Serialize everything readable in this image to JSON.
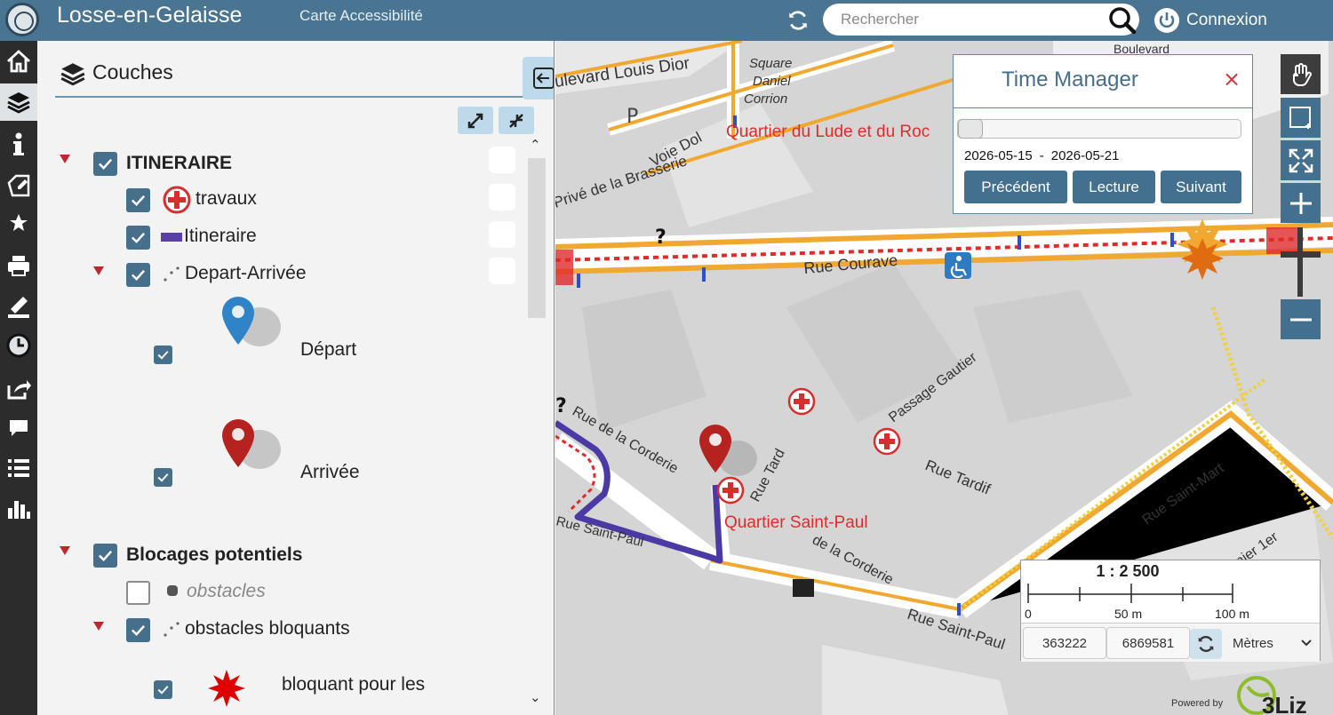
{
  "header": {
    "title": "Losse-en-Gelaisse",
    "subtitle": "Carte Accessibilité",
    "search_placeholder": "Rechercher",
    "login_label": "Connexion"
  },
  "menu": {
    "items": [
      "home-icon",
      "layers-icon",
      "info-icon",
      "edit-icon",
      "star-icon",
      "print-icon",
      "measure-icon",
      "clock-icon",
      "share-icon",
      "comment-icon",
      "list-icon",
      "chart-icon"
    ],
    "active": "layers-icon"
  },
  "panel": {
    "title": "Couches",
    "layers": {
      "itineraire": "ITINERAIRE",
      "travaux": "travaux",
      "itineraire_line": "Itineraire",
      "depart_arrivee": "Depart-Arrivée",
      "depart": "Départ",
      "arrivee": "Arrivée",
      "blocages": "Blocages potentiels",
      "obstacles": "obstacles",
      "obstacles_bloquants": "obstacles bloquants",
      "bloquant": "bloquant pour les"
    }
  },
  "map": {
    "labels": {
      "boulevard": "ulevard Louis Dior",
      "square": "Square",
      "square2": "Daniel",
      "square3": "Corrion",
      "quartier_lude": "Quartier du Lude et du Roc",
      "voie": "Voie Dol",
      "brasserie": "Privé de la Brasserie",
      "courave": "Rue Courave",
      "gautier": "Passage Gautier",
      "corderie": "Rue de la Corderie",
      "tardif": "Rue Tardif",
      "rue_tard": "Rue Tard",
      "quartier_saint_paul": "Quartier Saint-Paul",
      "corderie2": "de la Corderie",
      "saint_paul": "Rue Saint-Paul",
      "saint_paul2": "Rue Saint-Paul",
      "saint_mart": "Rue Saint-Mart",
      "premier": "ernier 1er",
      "boulevard2": "Boulevard"
    }
  },
  "time_manager": {
    "title": "Time Manager",
    "start_date": "2026-05-15",
    "separator": "-",
    "end_date": "2026-05-21",
    "slider_position": 0.0,
    "buttons": [
      "Précédent",
      "Lecture",
      "Suivant"
    ]
  },
  "scale": {
    "label": "1 : 2 500",
    "ticks": [
      "0",
      "50 m",
      "100 m"
    ]
  },
  "coords": {
    "x": "363222",
    "y": "6869581",
    "unit": "Mètres"
  },
  "footer": {
    "powered_by": "Powered by",
    "logo_text": "3Liz"
  },
  "colors": {
    "header": "#4a7592",
    "accent": "#44708f",
    "route": "#5a3fa6",
    "road": "#f0a830",
    "warning": "#e02b2b"
  }
}
